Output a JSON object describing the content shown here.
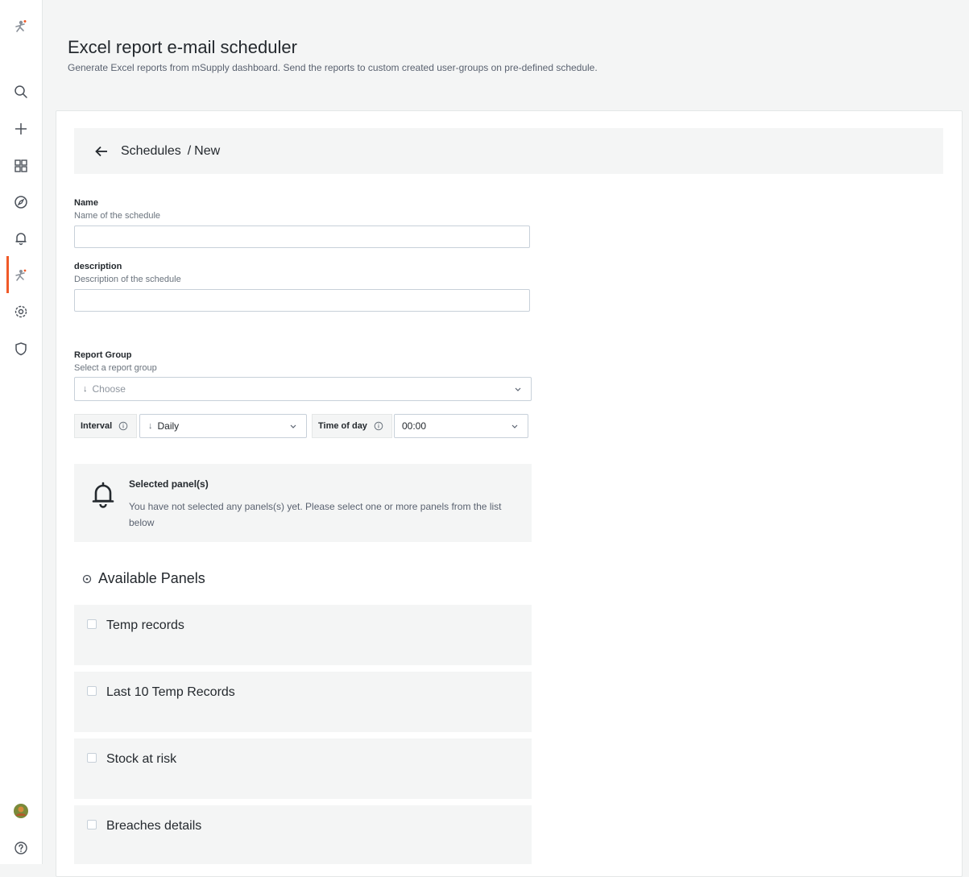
{
  "header": {
    "title": "Excel report e-mail scheduler",
    "subtitle": "Generate Excel reports from mSupply dashboard. Send the reports to custom created user-groups on pre-defined schedule."
  },
  "sidebar": {
    "icons": [
      "msupply-logo-icon",
      "search-icon",
      "plus-icon",
      "dashboards-icon",
      "explore-icon",
      "bell-icon",
      "msupply-app-icon",
      "gear-icon",
      "shield-icon",
      "avatar",
      "help-icon"
    ],
    "active_color": "#f05a28"
  },
  "breadcrumb": {
    "parent": "Schedules",
    "separator": "/",
    "current": "New"
  },
  "form": {
    "name_label": "Name",
    "name_desc": "Name of the schedule",
    "name_value": "",
    "description_label": "description",
    "description_desc": "Description of the schedule",
    "description_value": "",
    "report_group_label": "Report Group",
    "report_group_desc": "Select a report group",
    "report_group_placeholder": "Choose",
    "interval_label": "Interval",
    "interval_value": "Daily",
    "time_label": "Time of day",
    "time_value": "00:00"
  },
  "selected_panels": {
    "title": "Selected panel(s)",
    "message": "You have not selected any panels(s) yet. Please select one or more panels from the list below"
  },
  "available_panels": {
    "heading": "Available Panels",
    "items": [
      {
        "label": "Temp records",
        "checked": false
      },
      {
        "label": "Last 10 Temp Records",
        "checked": false
      },
      {
        "label": "Stock at risk",
        "checked": false
      },
      {
        "label": "Breaches details",
        "checked": false
      }
    ]
  }
}
